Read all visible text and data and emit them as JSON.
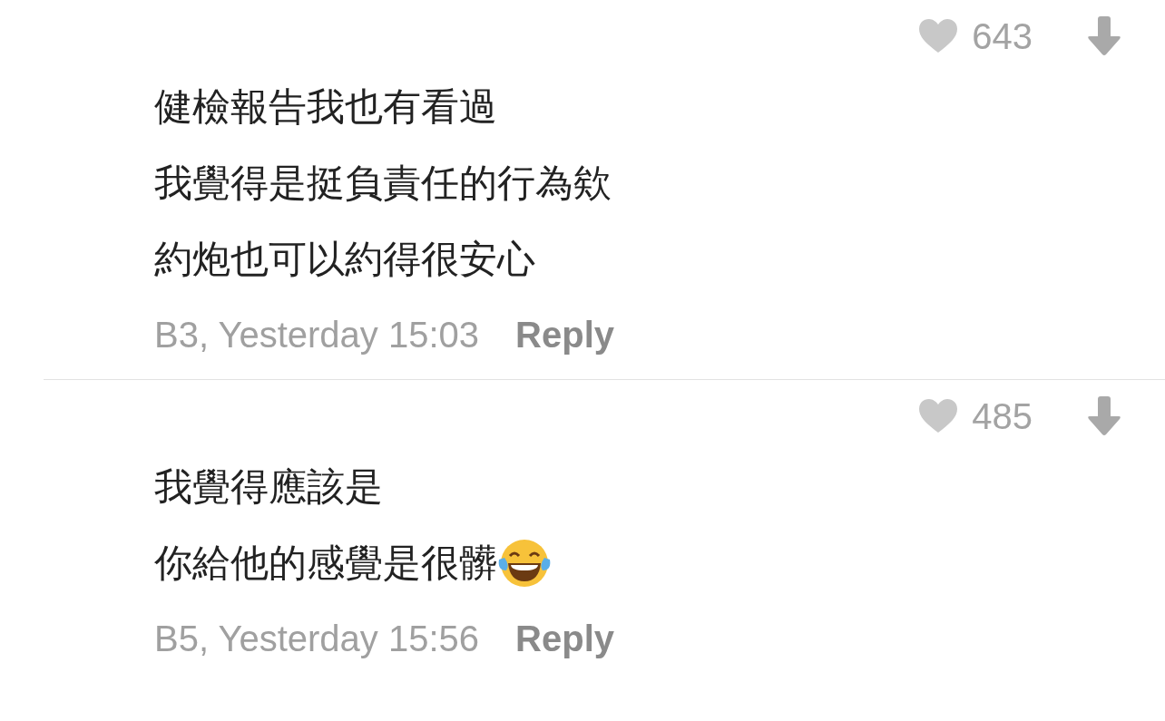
{
  "comments": [
    {
      "likes": "643",
      "lines": [
        {
          "text": "健檢報告我也有看過",
          "kind": "text"
        },
        {
          "text": "我覺得是挺負責任的行為欸",
          "kind": "text"
        },
        {
          "text": "約炮也可以約得很安心",
          "kind": "text"
        }
      ],
      "meta": "B3, Yesterday 15:03",
      "reply": "Reply"
    },
    {
      "likes": "485",
      "lines": [
        {
          "text": "我覺得應該是",
          "kind": "text"
        },
        {
          "text": "你給他的感覺是很髒",
          "kind": "text_emoji"
        }
      ],
      "meta": "B5, Yesterday 15:56",
      "reply": "Reply"
    }
  ]
}
